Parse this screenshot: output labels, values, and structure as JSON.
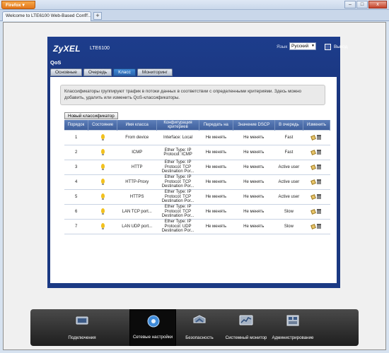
{
  "browser": {
    "firefox_label": "Firefox",
    "tab_title": "Welcome to LTE6100 Web-Based Confi...",
    "new_tab": "+",
    "controls": [
      "–",
      "□",
      "x"
    ]
  },
  "header": {
    "logo": "ZyXEL",
    "model": "LTE6100",
    "language_label": "Язык",
    "language_value": "Русский",
    "logout_label": "Выход",
    "section_title": "QoS"
  },
  "subtabs": [
    {
      "label": "Основные",
      "active": false
    },
    {
      "label": "Очередь",
      "active": false
    },
    {
      "label": "Класс",
      "active": true
    },
    {
      "label": "Мониторинг",
      "active": false
    }
  ],
  "info_text": "Классификаторы группируют трафик в потоки данных в соответствии с определенными критериями. Здесь можно добавить, удалить или изменить QoS-классификаторы.",
  "new_classifier_button": "Новый классификатор",
  "table": {
    "headers": [
      "Порядок",
      "Состояние",
      "Имя класса",
      "Конфигурация критериев",
      "Передать на",
      "Значение DSCP",
      "В очередь",
      "Изменить"
    ],
    "rows": [
      {
        "order": "1",
        "name": "From device",
        "criteria": "Interface: Local",
        "forward": "Не менять",
        "dscp": "Не менять",
        "queue": "Fast"
      },
      {
        "order": "2",
        "name": "ICMP",
        "criteria": "Ether Type: IP Protocol: ICMP",
        "forward": "Не менять",
        "dscp": "Не менять",
        "queue": "Fast"
      },
      {
        "order": "3",
        "name": "HTTP",
        "criteria": "Ether Type: IP Protocol: TCP Destination Por...",
        "forward": "Не менять",
        "dscp": "Не менять",
        "queue": "Active user"
      },
      {
        "order": "4",
        "name": "HTTP-Proxy",
        "criteria": "Ether Type: IP Protocol: TCP Destination Por...",
        "forward": "Не менять",
        "dscp": "Не менять",
        "queue": "Active user"
      },
      {
        "order": "5",
        "name": "HTTPS",
        "criteria": "Ether Type: IP Protocol: TCP Destination Por...",
        "forward": "Не менять",
        "dscp": "Не менять",
        "queue": "Active user"
      },
      {
        "order": "6",
        "name": "LAN TCP port...",
        "criteria": "Ether Type: IP Protocol: TCP Destination Por...",
        "forward": "Не менять",
        "dscp": "Не менять",
        "queue": "Slow"
      },
      {
        "order": "7",
        "name": "LAN UDP port...",
        "criteria": "Ether Type: IP Protocol: UDP Destination Por...",
        "forward": "Не менять",
        "dscp": "Не менять",
        "queue": "Slow"
      }
    ]
  },
  "dock": [
    {
      "label": "Подключения",
      "icon": "connections-icon",
      "active": false
    },
    {
      "label": "Сетевые настройки",
      "icon": "network-settings-icon",
      "active": true
    },
    {
      "label": "Безопасность",
      "icon": "security-icon",
      "active": false
    },
    {
      "label": "Системный монитор",
      "icon": "system-monitor-icon",
      "active": false
    },
    {
      "label": "Администрирование",
      "icon": "administration-icon",
      "active": false
    }
  ]
}
